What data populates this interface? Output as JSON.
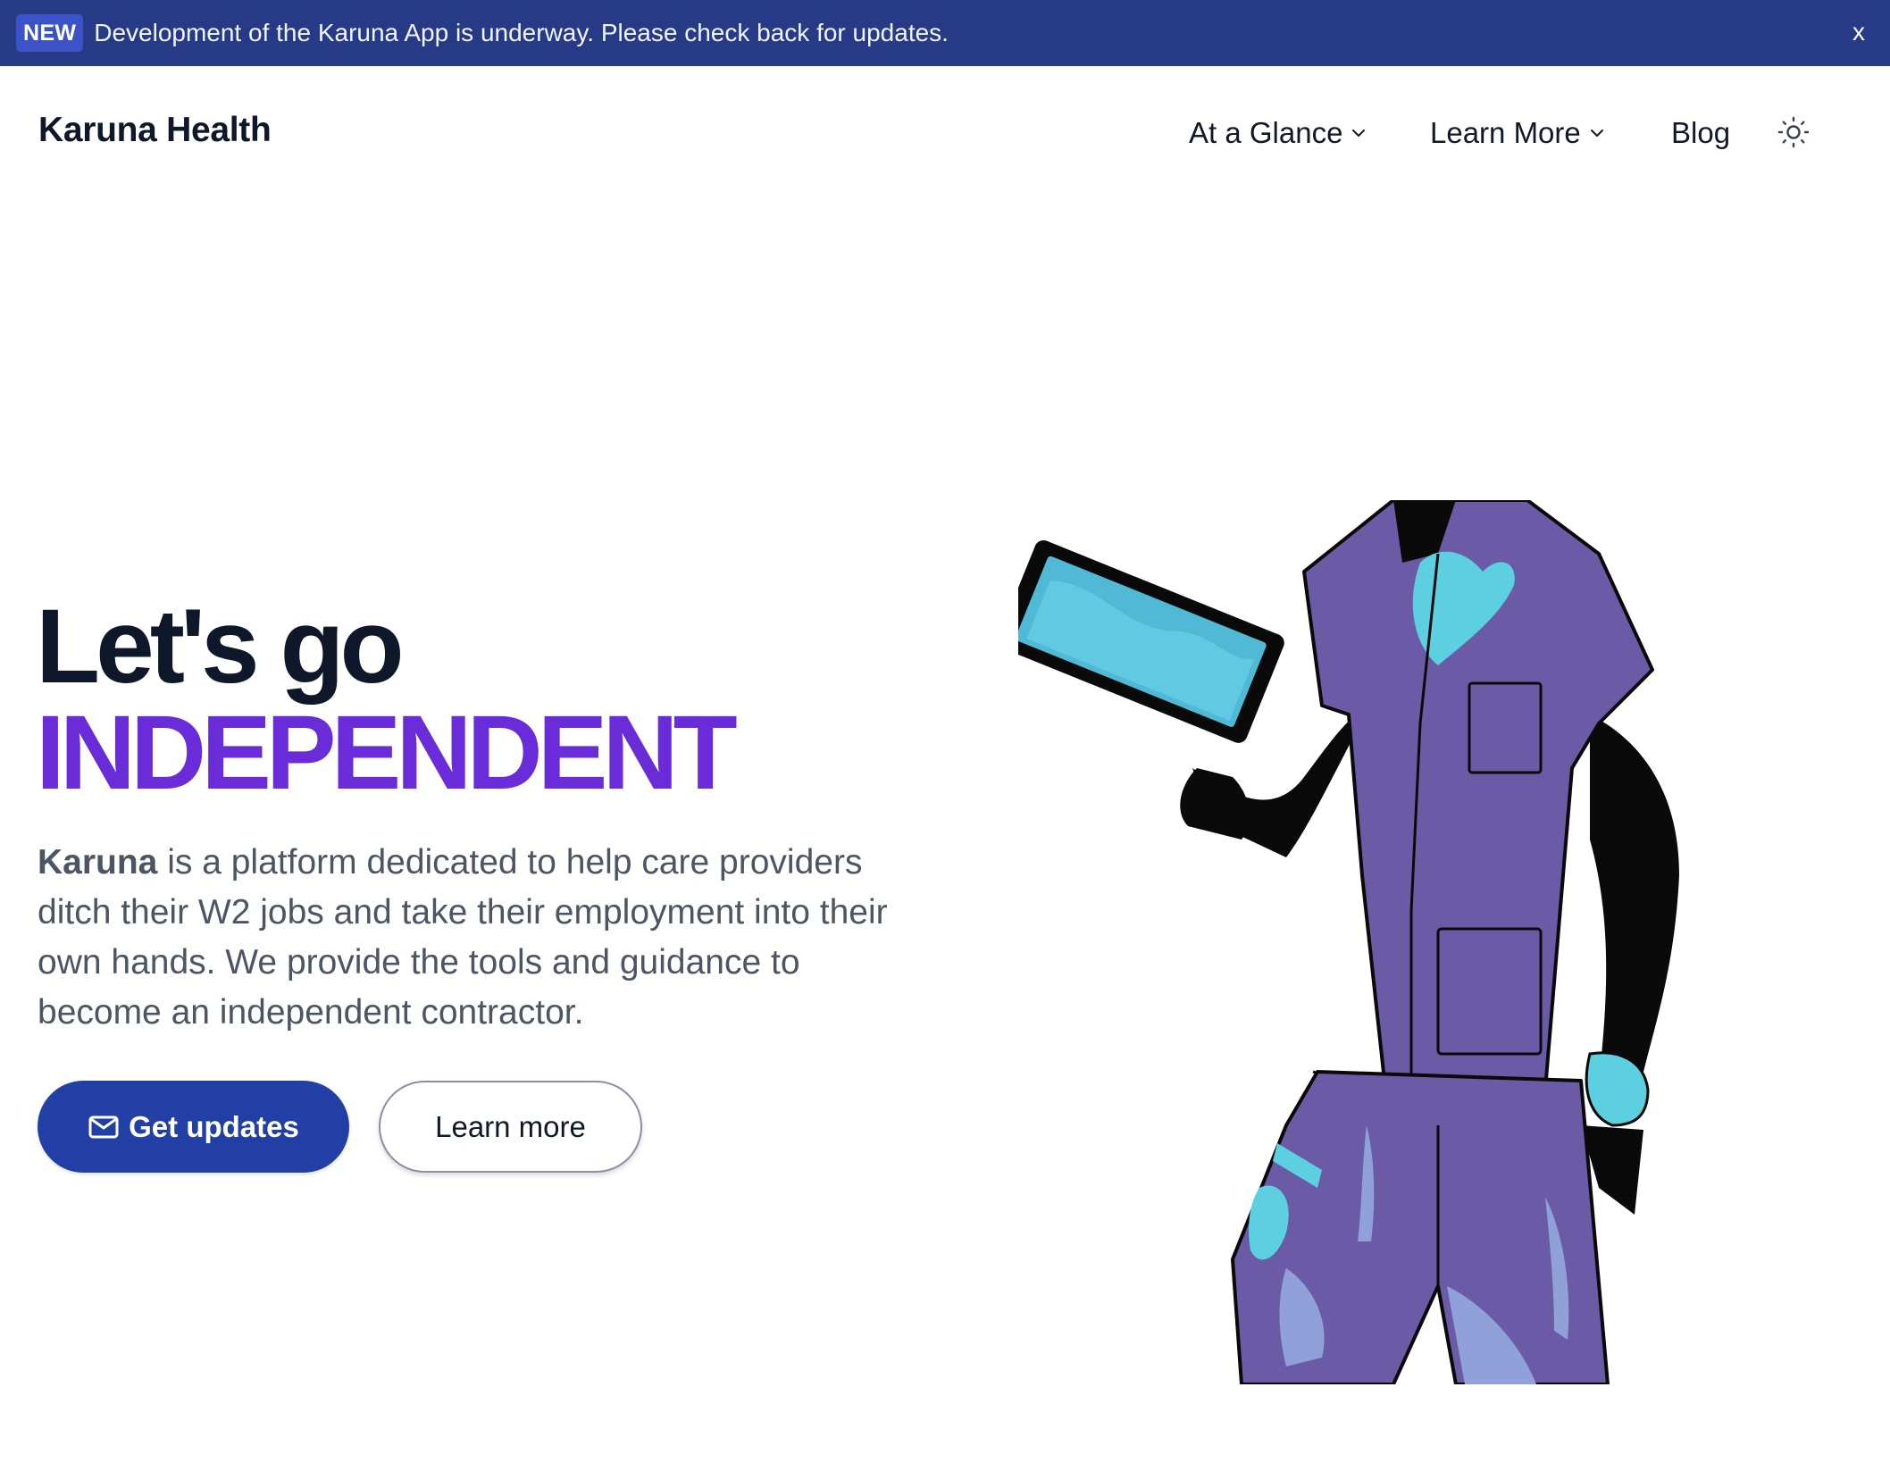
{
  "banner": {
    "badge": "NEW",
    "message": "Development of the Karuna App is underway. Please check back for updates.",
    "close_label": "x"
  },
  "header": {
    "logo": "Karuna Health",
    "nav": [
      {
        "label": "At a Glance",
        "has_dropdown": true,
        "icon": "chevron-down-icon"
      },
      {
        "label": "Learn More",
        "has_dropdown": true,
        "icon": "chevron-down-icon"
      },
      {
        "label": "Blog",
        "has_dropdown": false
      }
    ],
    "theme_toggle_icon": "sun-icon"
  },
  "hero": {
    "title_line1": "Let's go",
    "title_line2": "INDEPENDENT",
    "description_brand": "Karuna",
    "description_rest": " is a platform dedicated to help care providers ditch their W2 jobs and take their employment into their own hands. We provide the tools and guidance to become an independent contractor.",
    "primary_button": {
      "label": "Get updates",
      "icon": "mail-icon"
    },
    "secondary_button": {
      "label": "Learn more"
    },
    "illustration": "care-provider-with-tablet-illustration"
  },
  "colors": {
    "banner_bg": "#273a85",
    "badge_bg": "#3c53c8",
    "accent_purple": "#6a2bd9",
    "primary_button": "#223fa6",
    "heading": "#0f172a",
    "body_text": "#4b5563",
    "scrubs_purple": "#6b5ba6",
    "highlight_cyan": "#5ccfe0"
  }
}
